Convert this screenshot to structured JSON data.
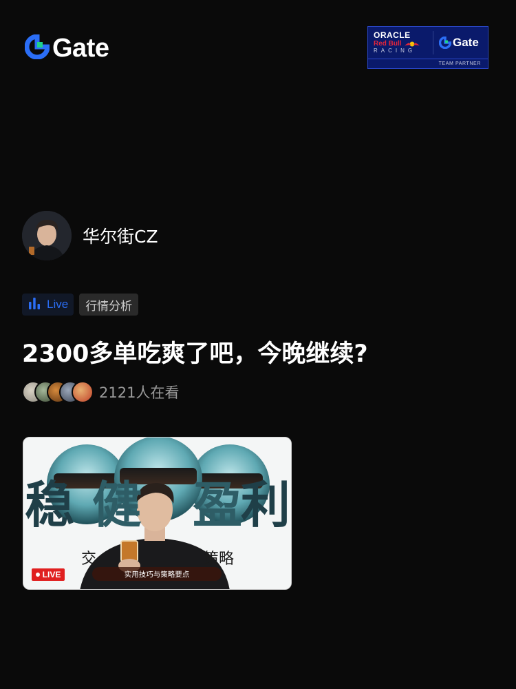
{
  "header": {
    "brand": "Gate",
    "partner": {
      "oracle": "ORACLE",
      "redbull": "Red Bull",
      "racing": "RACING",
      "gate": "Gate",
      "team": "TEAM PARTNER"
    }
  },
  "host": {
    "name": "华尔街CZ"
  },
  "tags": {
    "live": "Live",
    "category": "行情分析"
  },
  "stream": {
    "title": "2300多单吃爽了吧，今晚继续?",
    "viewers": "2121人在看"
  },
  "thumbnail": {
    "big_left": "稳",
    "big_mid": "健",
    "big_mid2": "盈",
    "big_right": "利",
    "sub_left": "交",
    "sub_right": "策略",
    "caption": "实用技巧与策略要点",
    "live_label": "LIVE"
  },
  "colors": {
    "accent": "#2b6ef6",
    "gate_green": "#1fd18a",
    "live_red": "#e02020",
    "background": "#0a0a0a"
  }
}
